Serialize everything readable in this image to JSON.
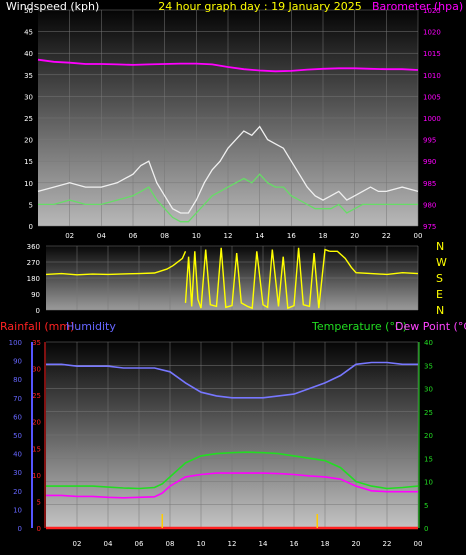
{
  "chart_data": [
    {
      "type": "line",
      "title": "24 hour graph day : 19 January 2025",
      "x_ticks": [
        "02",
        "04",
        "06",
        "08",
        "10",
        "12",
        "14",
        "16",
        "18",
        "20",
        "22",
        "00"
      ],
      "xlim_hours": [
        0,
        24
      ],
      "left_axis": {
        "label": "Windspeed (kph)",
        "range": [
          0,
          50
        ],
        "ticks": [
          "0",
          "5",
          "10",
          "15",
          "20",
          "25",
          "30",
          "35",
          "40",
          "45",
          "50"
        ]
      },
      "right_axis": {
        "label": "Barometer (hpa)",
        "range": [
          975,
          1025
        ],
        "ticks": [
          "975",
          "980",
          "985",
          "990",
          "995",
          "1000",
          "1005",
          "1010",
          "1015",
          "1020",
          "1025"
        ]
      },
      "grid": true,
      "series": [
        {
          "name": "Barometer (hpa)",
          "axis": "right",
          "color": "#ff00ff",
          "x": [
            0,
            1,
            2,
            3,
            4,
            5,
            6,
            7,
            8,
            9,
            10,
            11,
            12,
            13,
            14,
            15,
            16,
            17,
            18,
            19,
            20,
            21,
            22,
            23,
            24
          ],
          "values": [
            1013.5,
            1013,
            1012.8,
            1012.5,
            1012.5,
            1012.4,
            1012.3,
            1012.4,
            1012.5,
            1012.6,
            1012.6,
            1012.4,
            1011.8,
            1011.3,
            1011,
            1010.8,
            1010.9,
            1011.2,
            1011.4,
            1011.5,
            1011.5,
            1011.4,
            1011.3,
            1011.3,
            1011.1
          ]
        },
        {
          "name": "Wind gust",
          "axis": "left",
          "color": "#f0f0f0",
          "x": [
            0,
            1,
            2,
            3,
            4,
            5,
            6,
            6.5,
            7,
            7.5,
            8,
            8.5,
            9,
            9.5,
            10,
            10.5,
            11,
            11.5,
            12,
            12.5,
            13,
            13.5,
            14,
            14.5,
            15,
            15.5,
            16,
            16.5,
            17,
            17.5,
            18,
            18.5,
            19,
            19.5,
            20,
            20.5,
            21,
            21.5,
            22,
            23,
            24
          ],
          "values": [
            8,
            9,
            10,
            9,
            9,
            10,
            12,
            14,
            15,
            10,
            7,
            4,
            3,
            3,
            6,
            10,
            13,
            15,
            18,
            20,
            22,
            21,
            23,
            20,
            19,
            18,
            15,
            12,
            9,
            7,
            6,
            7,
            8,
            6,
            7,
            8,
            9,
            8,
            8,
            9,
            8
          ]
        },
        {
          "name": "Wind speed",
          "axis": "left",
          "color": "#66dd66",
          "x": [
            0,
            1,
            2,
            3,
            4,
            5,
            6,
            6.5,
            7,
            7.5,
            8,
            8.5,
            9,
            9.5,
            10,
            10.5,
            11,
            11.5,
            12,
            12.5,
            13,
            13.5,
            14,
            14.5,
            15,
            15.5,
            16,
            16.5,
            17,
            17.5,
            18,
            18.5,
            19,
            19.5,
            20,
            20.5,
            21,
            21.5,
            22,
            23,
            24
          ],
          "values": [
            5,
            5,
            6,
            5,
            5,
            6,
            7,
            8,
            9,
            6,
            4,
            2,
            1,
            1,
            3,
            5,
            7,
            8,
            9,
            10,
            11,
            10,
            12,
            10,
            9,
            9,
            7,
            6,
            5,
            4,
            4,
            4,
            5,
            3,
            4,
            5,
            5,
            5,
            5,
            5,
            5
          ]
        }
      ]
    },
    {
      "type": "line",
      "title": "",
      "xlim_hours": [
        0,
        24
      ],
      "left_axis": {
        "range": [
          0,
          360
        ],
        "ticks": [
          "0",
          "90",
          "180",
          "270",
          "360"
        ]
      },
      "compass_labels": [
        "N",
        "W",
        "S",
        "E",
        "N"
      ],
      "series": [
        {
          "name": "Wind direction",
          "color": "#ffff00",
          "x": [
            0,
            1,
            2,
            3,
            4,
            5,
            6,
            7,
            7.8,
            8.2,
            8.8,
            9.0
          ],
          "values": [
            200,
            205,
            198,
            202,
            200,
            203,
            205,
            208,
            230,
            250,
            290,
            330
          ]
        },
        {
          "name": "Wind direction (scattered)",
          "color": "#ffff00",
          "x": [
            9,
            9.2,
            9.4,
            9.6,
            9.8,
            10,
            10.3,
            10.6,
            11,
            11.3,
            11.6,
            12,
            12.3,
            12.6,
            13,
            13.3,
            13.6,
            14,
            14.3,
            14.6,
            15,
            15.3,
            15.6,
            16,
            16.3,
            16.6,
            17,
            17.3,
            17.6,
            18,
            18.3
          ],
          "values": [
            40,
            300,
            20,
            330,
            60,
            10,
            340,
            30,
            20,
            350,
            15,
            25,
            320,
            40,
            20,
            10,
            330,
            30,
            15,
            340,
            20,
            300,
            10,
            25,
            350,
            30,
            20,
            320,
            10,
            340,
            330
          ]
        },
        {
          "name": "Wind direction (late)",
          "color": "#ffff00",
          "x": [
            18.3,
            18.8,
            19.3,
            19.7,
            20,
            21,
            22,
            23,
            24
          ],
          "values": [
            330,
            330,
            290,
            240,
            210,
            205,
            200,
            210,
            205
          ]
        }
      ]
    },
    {
      "type": "line",
      "title": "",
      "x_ticks": [
        "02",
        "04",
        "06",
        "08",
        "10",
        "12",
        "14",
        "16",
        "18",
        "20",
        "22",
        "00"
      ],
      "xlim_hours": [
        0,
        24
      ],
      "left_axes": [
        {
          "label": "Humidity",
          "color": "#5555ff",
          "range": [
            0,
            100
          ],
          "ticks": [
            "0",
            "10",
            "20",
            "30",
            "40",
            "50",
            "60",
            "70",
            "80",
            "90",
            "100"
          ]
        },
        {
          "label": "Rainfall (mm)",
          "color": "#ff2222",
          "range": [
            0,
            35
          ],
          "ticks": [
            "0",
            "5",
            "10",
            "15",
            "20",
            "25",
            "30",
            "35"
          ]
        }
      ],
      "right_axis": {
        "label": "Temperature (°C)",
        "label2": "Dew Point (°C)",
        "range": [
          0,
          40
        ],
        "ticks": [
          "0",
          "5",
          "10",
          "15",
          "20",
          "25",
          "30",
          "35",
          "40"
        ]
      },
      "series": [
        {
          "name": "Humidity",
          "axis": "left1",
          "color": "#7777ff",
          "x": [
            0,
            1,
            2,
            3,
            4,
            5,
            6,
            7,
            8,
            9,
            10,
            11,
            12,
            13,
            14,
            15,
            16,
            17,
            18,
            19,
            20,
            21,
            22,
            23,
            24
          ],
          "values": [
            88,
            88,
            87,
            87,
            87,
            86,
            86,
            86,
            84,
            78,
            73,
            71,
            70,
            70,
            70,
            71,
            72,
            75,
            78,
            82,
            88,
            89,
            89,
            88,
            88
          ]
        },
        {
          "name": "Temperature (°C)",
          "axis": "right",
          "color": "#22dd22",
          "x": [
            0,
            1,
            2,
            3,
            4,
            5,
            6,
            7,
            7.5,
            8,
            9,
            10,
            11,
            12,
            13,
            14,
            15,
            16,
            17,
            18,
            19,
            20,
            21,
            22,
            23,
            24
          ],
          "values": [
            9,
            9,
            9,
            9,
            8.8,
            8.6,
            8.5,
            8.7,
            9.5,
            11,
            14,
            15.5,
            16,
            16.2,
            16.3,
            16.2,
            16,
            15.5,
            15,
            14.5,
            13,
            10,
            9,
            8.5,
            8.7,
            9
          ]
        },
        {
          "name": "Dew Point (°C)",
          "axis": "right",
          "color": "#ff00ff",
          "x": [
            0,
            1,
            2,
            3,
            4,
            5,
            6,
            7,
            7.5,
            8,
            9,
            10,
            11,
            12,
            13,
            14,
            15,
            16,
            17,
            18,
            19,
            20,
            21,
            22,
            23,
            24
          ],
          "values": [
            7,
            7,
            6.8,
            6.8,
            6.6,
            6.5,
            6.6,
            6.7,
            7.5,
            9,
            11,
            11.5,
            11.8,
            11.8,
            11.8,
            11.8,
            11.7,
            11.5,
            11.2,
            11,
            10.5,
            9,
            8,
            7.8,
            7.8,
            7.8
          ]
        },
        {
          "name": "Rainfall (mm)",
          "axis": "left2",
          "color": "#ff2222",
          "x": [
            0,
            24
          ],
          "values": [
            0,
            0
          ]
        }
      ],
      "markers": {
        "color": "#ffcc00",
        "x_hours": [
          7.5,
          17.5
        ]
      }
    }
  ]
}
